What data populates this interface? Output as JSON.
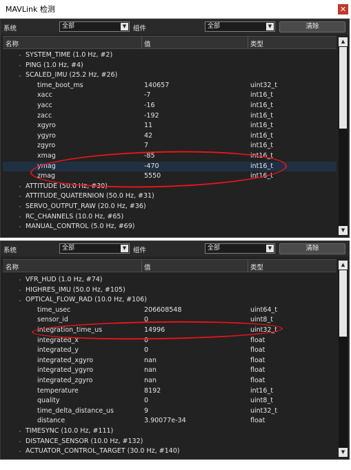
{
  "window": {
    "title": "MAVLink 检测",
    "close_glyph": "✕"
  },
  "panels": [
    {
      "system_label": "系统",
      "system_value": "全部",
      "component_label": "组件",
      "component_value": "全部",
      "clear_label": "清除",
      "columns": {
        "name": "名称",
        "value": "值",
        "type": "类型"
      },
      "rows": [
        {
          "name": "SYSTEM_TIME (1.0 Hz, #2)",
          "value": "",
          "type": "",
          "level": 0
        },
        {
          "name": "PING (1.0 Hz, #4)",
          "value": "",
          "type": "",
          "level": 0
        },
        {
          "name": "SCALED_IMU (25.2 Hz, #26)",
          "value": "",
          "type": "",
          "level": 0,
          "expanded": true
        },
        {
          "name": "time_boot_ms",
          "value": "140657",
          "type": "uint32_t",
          "level": 1
        },
        {
          "name": "xacc",
          "value": "-7",
          "type": "int16_t",
          "level": 1
        },
        {
          "name": "yacc",
          "value": "-16",
          "type": "int16_t",
          "level": 1
        },
        {
          "name": "zacc",
          "value": "-192",
          "type": "int16_t",
          "level": 1
        },
        {
          "name": "xgyro",
          "value": "11",
          "type": "int16_t",
          "level": 1
        },
        {
          "name": "ygyro",
          "value": "42",
          "type": "int16_t",
          "level": 1
        },
        {
          "name": "zgyro",
          "value": "7",
          "type": "int16_t",
          "level": 1
        },
        {
          "name": "xmag",
          "value": "-85",
          "type": "int16_t",
          "level": 1
        },
        {
          "name": "ymag",
          "value": "-470",
          "type": "int16_t",
          "level": 1,
          "selected": true
        },
        {
          "name": "zmag",
          "value": "5550",
          "type": "int16_t",
          "level": 1
        },
        {
          "name": "ATTITUDE (50.0 Hz, #30)",
          "value": "",
          "type": "",
          "level": 0
        },
        {
          "name": "ATTITUDE_QUATERNION (50.0 Hz, #31)",
          "value": "",
          "type": "",
          "level": 0
        },
        {
          "name": "SERVO_OUTPUT_RAW (20.0 Hz, #36)",
          "value": "",
          "type": "",
          "level": 0
        },
        {
          "name": "RC_CHANNELS (10.0 Hz, #65)",
          "value": "",
          "type": "",
          "level": 0
        },
        {
          "name": "MANUAL_CONTROL (5.0 Hz, #69)",
          "value": "",
          "type": "",
          "level": 0
        }
      ]
    },
    {
      "system_label": "系统",
      "system_value": "全部",
      "component_label": "组件",
      "component_value": "全部",
      "clear_label": "清除",
      "columns": {
        "name": "名称",
        "value": "值",
        "type": "类型"
      },
      "rows": [
        {
          "name": "VFR_HUD (1.0 Hz, #74)",
          "value": "",
          "type": "",
          "level": 0
        },
        {
          "name": "HIGHRES_IMU (50.0 Hz, #105)",
          "value": "",
          "type": "",
          "level": 0
        },
        {
          "name": "OPTICAL_FLOW_RAD (10.0 Hz, #106)",
          "value": "",
          "type": "",
          "level": 0,
          "expanded": true
        },
        {
          "name": "time_usec",
          "value": "206608548",
          "type": "uint64_t",
          "level": 1
        },
        {
          "name": "sensor_id",
          "value": "0",
          "type": "uint8_t",
          "level": 1
        },
        {
          "name": "integration_time_us",
          "value": "14996",
          "type": "uint32_t",
          "level": 1
        },
        {
          "name": "integrated_x",
          "value": "0",
          "type": "float",
          "level": 1
        },
        {
          "name": "integrated_y",
          "value": "0",
          "type": "float",
          "level": 1
        },
        {
          "name": "integrated_xgyro",
          "value": "nan",
          "type": "float",
          "level": 1
        },
        {
          "name": "integrated_ygyro",
          "value": "nan",
          "type": "float",
          "level": 1
        },
        {
          "name": "integrated_zgyro",
          "value": "nan",
          "type": "float",
          "level": 1
        },
        {
          "name": "temperature",
          "value": "8192",
          "type": "int16_t",
          "level": 1
        },
        {
          "name": "quality",
          "value": "0",
          "type": "uint8_t",
          "level": 1
        },
        {
          "name": "time_delta_distance_us",
          "value": "9",
          "type": "uint32_t",
          "level": 1
        },
        {
          "name": "distance",
          "value": "3.90077e-34",
          "type": "float",
          "level": 1
        },
        {
          "name": "TIMESYNC (10.0 Hz, #111)",
          "value": "",
          "type": "",
          "level": 0
        },
        {
          "name": "DISTANCE_SENSOR (10.0 Hz, #132)",
          "value": "",
          "type": "",
          "level": 0
        },
        {
          "name": "ACTUATOR_CONTROL_TARGET (30.0 Hz, #140)",
          "value": "",
          "type": "",
          "level": 0
        }
      ]
    }
  ],
  "colors": {
    "panel_bg": "#222222",
    "selection": "#1f3042",
    "annotation": "#e8141a"
  }
}
